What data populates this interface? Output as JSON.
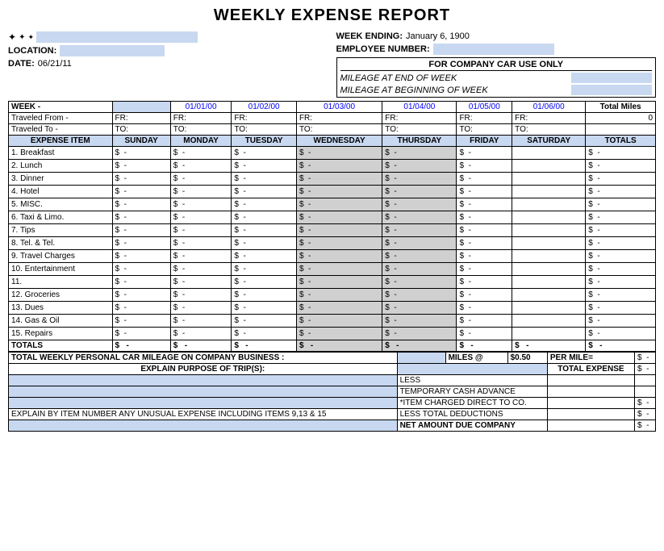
{
  "title": "WEEKLY EXPENSE REPORT",
  "header": {
    "week_ending_label": "WEEK ENDING:",
    "week_ending_value": "January 6, 1900",
    "employee_number_label": "EMPLOYEE NUMBER:",
    "employee_number_value": "",
    "location_label": "LOCATION:",
    "location_value": "",
    "date_label": "DATE:",
    "date_value": "06/21/11",
    "icons": [
      "✦",
      "✦",
      "✦"
    ]
  },
  "company_car": {
    "title": "FOR COMPANY CAR USE ONLY",
    "mileage_end_label": "MILEAGE AT END OF WEEK",
    "mileage_begin_label": "MILEAGE AT BEGINNING OF WEEK"
  },
  "week_row": {
    "label": "WEEK -",
    "dates": [
      "01/01/00",
      "01/02/00",
      "01/03/00",
      "01/04/00",
      "01/05/00",
      "01/06/00"
    ],
    "total_miles_label": "Total Miles",
    "total_miles_value": "0"
  },
  "traveled_from": {
    "label": "Traveled From -",
    "fr_labels": [
      "FR:",
      "FR:",
      "FR:",
      "FR:",
      "FR:",
      "FR:",
      "FR:"
    ]
  },
  "traveled_to": {
    "label": "Traveled To -",
    "to_labels": [
      "TO:",
      "TO:",
      "TO:",
      "TO:",
      "TO:",
      "TO:",
      "TO:"
    ]
  },
  "columns": {
    "expense_item": "EXPENSE ITEM",
    "days": [
      "SUNDAY",
      "MONDAY",
      "TUESDAY",
      "WEDNESDAY",
      "THURSDAY",
      "FRIDAY",
      "SATURDAY"
    ],
    "totals": "TOTALS"
  },
  "expense_items": [
    {
      "num": "1.",
      "name": "Breakfast"
    },
    {
      "num": "2.",
      "name": "Lunch"
    },
    {
      "num": "3.",
      "name": "Dinner"
    },
    {
      "num": "4.",
      "name": "Hotel"
    },
    {
      "num": "5.",
      "name": "MISC."
    },
    {
      "num": "6.",
      "name": "Taxi & Limo."
    },
    {
      "num": "7.",
      "name": "Tips"
    },
    {
      "num": "8.",
      "name": "Tel. & Tel."
    },
    {
      "num": "9.",
      "name": "Travel Charges"
    },
    {
      "num": "10.",
      "name": "Entertainment"
    },
    {
      "num": "11.",
      "name": ""
    },
    {
      "num": "12.",
      "name": "Groceries"
    },
    {
      "num": "13.",
      "name": "Dues"
    },
    {
      "num": "14.",
      "name": "Gas & Oil"
    },
    {
      "num": "15.",
      "name": "Repairs"
    }
  ],
  "totals_row_label": "TOTALS",
  "bottom": {
    "mileage_label": "TOTAL WEEKLY PERSONAL CAR MILEAGE ON COMPANY BUSINESS :",
    "miles_at_label": "MILES @",
    "miles_rate": "$0.50",
    "per_mile_label": "PER MILE=",
    "explain_label": "EXPLAIN PURPOSE OF TRIP(S):",
    "total_expense_label": "TOTAL EXPENSE",
    "less_label": "LESS",
    "temp_advance_label": "TEMPORARY CASH ADVANCE",
    "item_charged_label": "*ITEM CHARGED DIRECT TO CO.",
    "less_deductions_label": "LESS TOTAL DEDUCTIONS",
    "net_amount_label": "NET AMOUNT DUE COMPANY",
    "explain_items_label": "EXPLAIN BY ITEM NUMBER ANY UNUSUAL EXPENSE INCLUDING ITEMS 9,13 & 15"
  }
}
